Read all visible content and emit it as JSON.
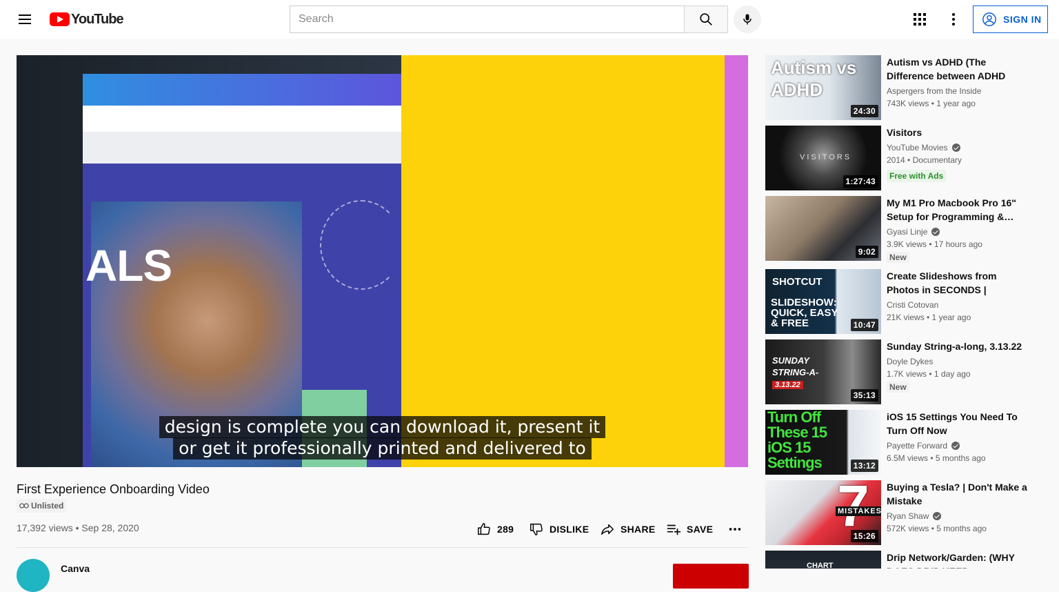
{
  "header": {
    "logo_text": "YouTube",
    "search_placeholder": "Search",
    "signin_label": "SIGN IN"
  },
  "player": {
    "frame_text": "ALS",
    "captions": [
      "design is complete you can download it, present it",
      "or get it professionally printed and delivered to"
    ]
  },
  "video": {
    "title": "First Experience Onboarding Video",
    "visibility": "Unlisted",
    "views": "17,392 views",
    "date": "Sep 28, 2020",
    "likes": "289",
    "dislike_label": "DISLIKE",
    "share_label": "SHARE",
    "save_label": "SAVE",
    "channel_name": "Canva"
  },
  "recommendations": [
    {
      "title": "Autism vs ADHD (The Difference between ADHD and…",
      "channel": "Aspergers from the Inside",
      "verified": false,
      "meta": "743K views • 1 year ago",
      "duration": "24:30",
      "thumb_text": "Autism vs ADHD"
    },
    {
      "title": "Visitors",
      "channel": "YouTube Movies",
      "verified": true,
      "meta": "2014 • Documentary",
      "badge": "Free with Ads",
      "duration": "1:27:43",
      "thumb_text": "VISITORS"
    },
    {
      "title": "My M1 Pro Macbook Pro 16\" Setup for Programming &…",
      "channel": "Gyasi Linje",
      "verified": true,
      "meta": "3.9K views • 17 hours ago",
      "badge": "New",
      "duration": "9:02"
    },
    {
      "title": "Create Slideshows from Photos in SECONDS | Quickest, Easies…",
      "channel": "Cristi Cotovan",
      "verified": false,
      "meta": "21K views • 1 year ago",
      "duration": "10:47",
      "thumb_text": "SHOTCUT",
      "thumb_text2": "SLIDESHOW: QUICK, EASY & FREE"
    },
    {
      "title": "Sunday String-a-long, 3.13.22",
      "channel": "Doyle Dykes",
      "verified": false,
      "meta": "1.7K views • 1 day ago",
      "badge": "New",
      "duration": "35:13",
      "thumb_text": "SUNDAY STRING-A-LONG",
      "thumb_text2": "3.13.22"
    },
    {
      "title": "iOS 15 Settings You Need To Turn Off Now",
      "channel": "Payette Forward",
      "verified": true,
      "meta": "6.5M views • 5 months ago",
      "duration": "13:12",
      "thumb_text": "Turn Off These 15 iOS 15 Settings"
    },
    {
      "title": "Buying a Tesla? | Don't Make a Mistake",
      "channel": "Ryan Shaw",
      "verified": true,
      "meta": "572K views • 5 months ago",
      "duration": "15:26",
      "thumb_text": "7",
      "thumb_text2": "MISTAKES"
    },
    {
      "title": "Drip Network/Garden: (WHY DOES DRIP KEEP FALLING???)",
      "thumb_text": "CHART"
    }
  ],
  "colors": {
    "brand_red": "#ff0000",
    "link_blue": "#065fd4",
    "caption_bg": "#080808",
    "video_yellow": "#fdd20a"
  }
}
